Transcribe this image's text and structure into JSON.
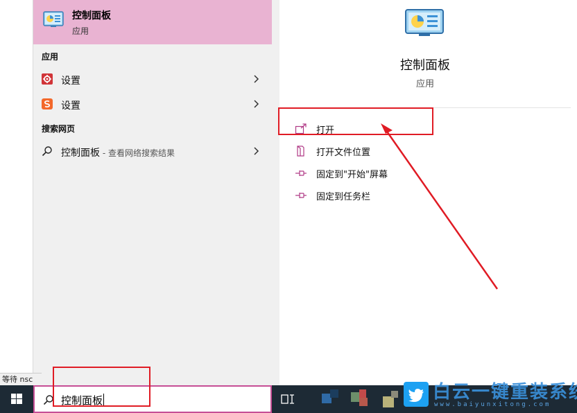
{
  "best_match": {
    "title": "控制面板",
    "subtitle": "应用"
  },
  "sections": {
    "apps_header": "应用",
    "web_header": "搜索网页"
  },
  "app_results": [
    {
      "label": "设置",
      "icon": "settings-gear-icon",
      "icon_color": "#d13438"
    },
    {
      "label": "设置",
      "icon": "sogou-s-icon",
      "icon_color": "#f3682b"
    }
  ],
  "web_result": {
    "label": "控制面板",
    "suffix": " - 查看网络搜索结果"
  },
  "details": {
    "title": "控制面板",
    "subtitle": "应用",
    "actions": [
      {
        "label": "打开",
        "icon": "open-icon"
      },
      {
        "label": "打开文件位置",
        "icon": "file-location-icon"
      },
      {
        "label": "固定到\"开始\"屏幕",
        "icon": "pin-icon"
      },
      {
        "label": "固定到任务栏",
        "icon": "pin-icon"
      }
    ]
  },
  "taskbar": {
    "search_value": "控制面板"
  },
  "status_text": "等待 nsc",
  "watermark": {
    "text": "白云一键重装系统",
    "url": "www.baiyunxitong.com"
  },
  "colors": {
    "highlight": "#e9b3d2",
    "accent": "#c64e95",
    "annotation": "#e01b24",
    "taskbar": "#1d2a35"
  }
}
